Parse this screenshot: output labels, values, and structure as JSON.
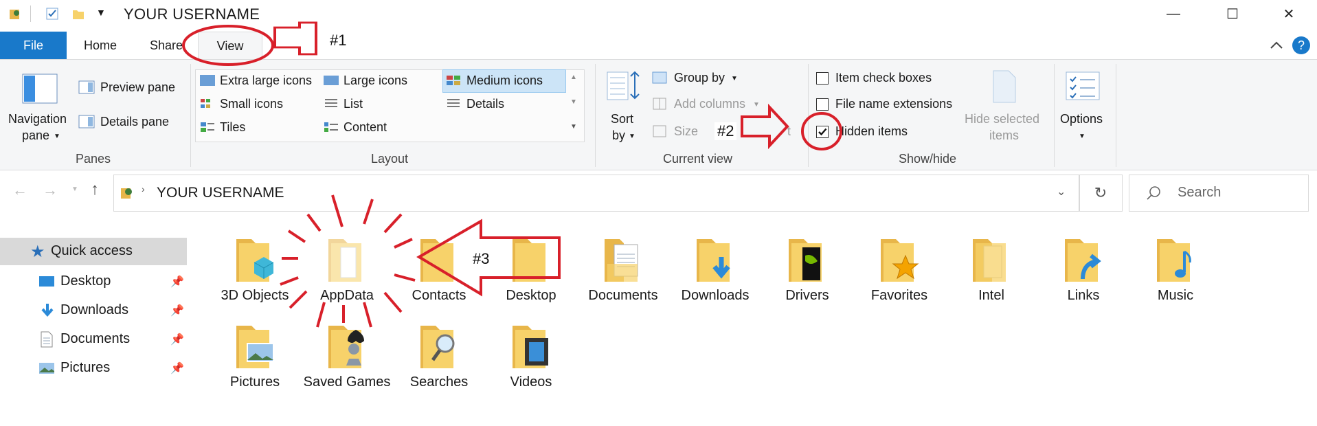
{
  "window": {
    "title": "YOUR USERNAME",
    "controls": {
      "minimize": "—",
      "maximize": "☐",
      "close": "✕"
    }
  },
  "tabs": [
    "File",
    "Home",
    "Share",
    "View"
  ],
  "ribbon": {
    "panes": {
      "navigation_pane": "Navigation",
      "navigation_pane2": "pane",
      "preview_pane": "Preview pane",
      "details_pane": "Details pane",
      "group_label": "Panes"
    },
    "layout": {
      "options": [
        "Extra large icons",
        "Large icons",
        "Medium icons",
        "Small icons",
        "List",
        "Details",
        "Tiles",
        "Content"
      ],
      "selected": "Medium icons",
      "group_label": "Layout"
    },
    "current_view": {
      "sort_by": "Sort",
      "sort_by2": "by",
      "group_by": "Group by",
      "add_columns": "Add columns",
      "size_all_columns": "Size",
      "size_all_columns_tail": "t",
      "group_label": "Current view"
    },
    "show_hide": {
      "item_check_boxes": "Item check boxes",
      "file_name_extensions": "File name extensions",
      "hidden_items": "Hidden items",
      "hidden_items_checked": true,
      "hide_selected": "Hide selected",
      "hide_selected2": "items",
      "group_label": "Show/hide"
    },
    "options": {
      "label": "Options"
    }
  },
  "address": {
    "path": "YOUR USERNAME",
    "search_placeholder": "Search"
  },
  "nav_pane": {
    "quick_access": "Quick access",
    "items": [
      "Desktop",
      "Downloads",
      "Documents",
      "Pictures"
    ]
  },
  "folders": [
    "3D Objects",
    "AppData",
    "Contacts",
    "Desktop",
    "Documents",
    "Downloads",
    "Drivers",
    "Favorites",
    "Intel",
    "Links",
    "Music",
    "Pictures",
    "Saved Games",
    "Searches",
    "Videos"
  ],
  "annotations": {
    "a1": "#1",
    "a2": "#2",
    "a3": "#3"
  },
  "colors": {
    "accent": "#1979ca",
    "folder": "#f7d26a",
    "annotation": "#d8202a"
  }
}
